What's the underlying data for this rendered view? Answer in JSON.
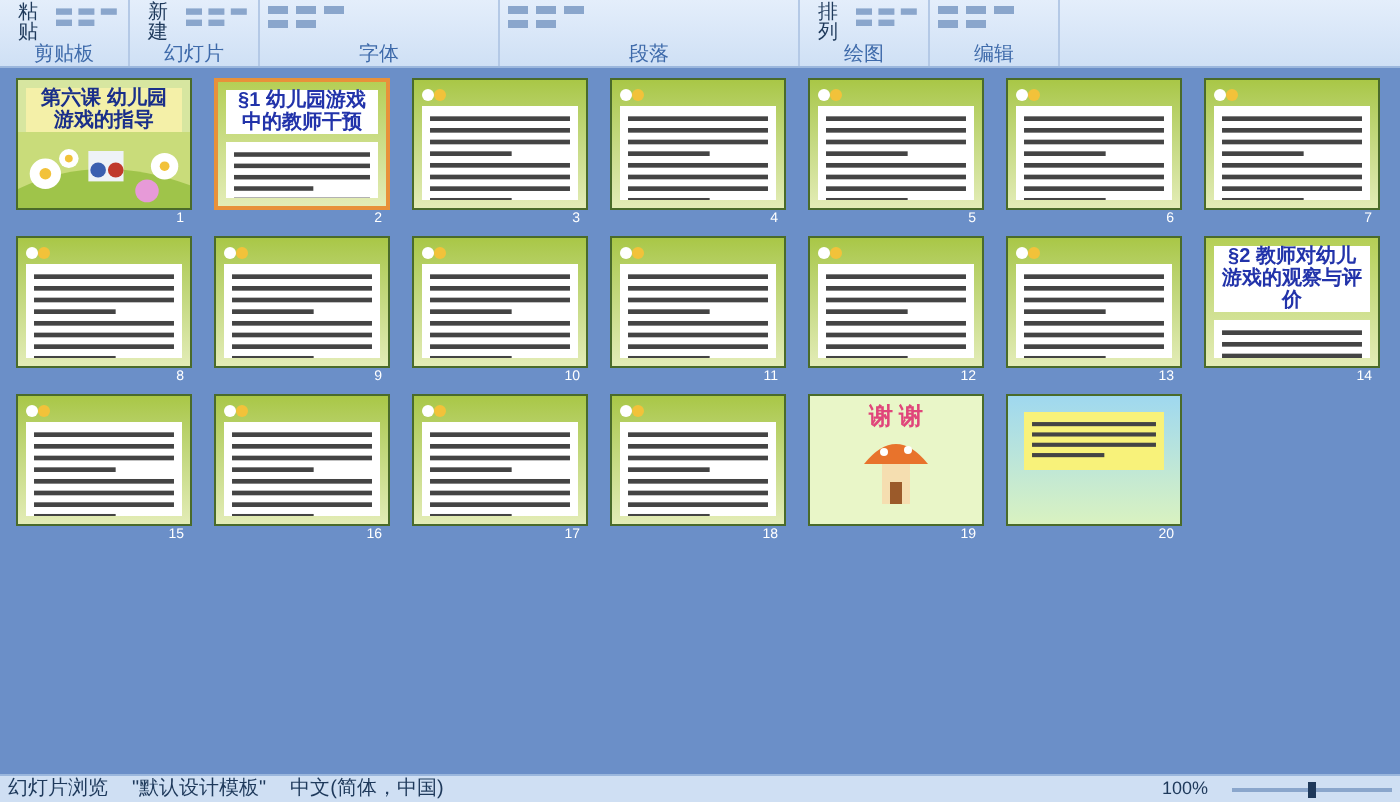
{
  "ribbon": {
    "groups": [
      {
        "label": "剪贴板",
        "buttons": [
          "粘贴"
        ]
      },
      {
        "label": "幻灯片",
        "buttons": [
          "新建"
        ]
      },
      {
        "label": "字体"
      },
      {
        "label": "段落"
      },
      {
        "label": "绘图",
        "buttons": [
          "排列"
        ]
      },
      {
        "label": "编辑"
      }
    ]
  },
  "slides": [
    {
      "number": "1",
      "kind": "title",
      "title": "第六课 幼儿园游戏的指导",
      "selected": false
    },
    {
      "number": "2",
      "kind": "section",
      "title": "§1 幼儿园游戏中的教师干预",
      "selected": true
    },
    {
      "number": "3",
      "kind": "text",
      "selected": false
    },
    {
      "number": "4",
      "kind": "text",
      "selected": false
    },
    {
      "number": "5",
      "kind": "text",
      "selected": false
    },
    {
      "number": "6",
      "kind": "text",
      "selected": false
    },
    {
      "number": "7",
      "kind": "text",
      "selected": false
    },
    {
      "number": "8",
      "kind": "text",
      "selected": false
    },
    {
      "number": "9",
      "kind": "text",
      "selected": false
    },
    {
      "number": "10",
      "kind": "text",
      "selected": false
    },
    {
      "number": "11",
      "kind": "text",
      "selected": false
    },
    {
      "number": "12",
      "kind": "text",
      "selected": false
    },
    {
      "number": "13",
      "kind": "text",
      "selected": false
    },
    {
      "number": "14",
      "kind": "section",
      "title": "§2 教师对幼儿游戏的观察与评价",
      "selected": false
    },
    {
      "number": "15",
      "kind": "text",
      "selected": false
    },
    {
      "number": "16",
      "kind": "text",
      "selected": false
    },
    {
      "number": "17",
      "kind": "text",
      "selected": false
    },
    {
      "number": "18",
      "kind": "text",
      "selected": false
    },
    {
      "number": "19",
      "kind": "thanks",
      "title": "谢 谢",
      "selected": false
    },
    {
      "number": "20",
      "kind": "note",
      "selected": false
    }
  ],
  "status_bar": {
    "view": "幻灯片浏览",
    "theme": "\"默认设计模板\"",
    "language": "中文(简体，中国)",
    "zoom": "100%",
    "zoom_slider": {
      "level": 0.5
    }
  }
}
